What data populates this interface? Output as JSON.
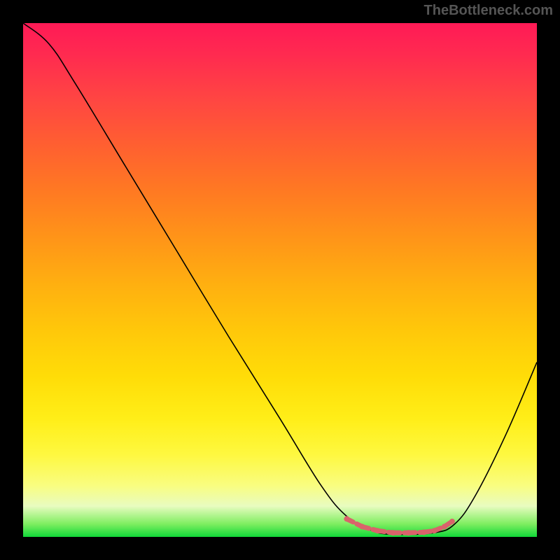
{
  "watermark": "TheBottleneck.com",
  "chart_data": {
    "type": "line",
    "title": "",
    "xlabel": "",
    "ylabel": "",
    "xlim": [
      0,
      100
    ],
    "ylim": [
      0,
      100
    ],
    "grid": false,
    "series": [
      {
        "name": "curve",
        "color": "#000000",
        "points": [
          {
            "x": 0,
            "y": 100
          },
          {
            "x": 5,
            "y": 96
          },
          {
            "x": 10,
            "y": 88.5
          },
          {
            "x": 20,
            "y": 72
          },
          {
            "x": 30,
            "y": 55.5
          },
          {
            "x": 40,
            "y": 39
          },
          {
            "x": 50,
            "y": 23
          },
          {
            "x": 58,
            "y": 10
          },
          {
            "x": 63,
            "y": 4
          },
          {
            "x": 68,
            "y": 1.2
          },
          {
            "x": 72,
            "y": 0.5
          },
          {
            "x": 80,
            "y": 0.8
          },
          {
            "x": 84,
            "y": 2.5
          },
          {
            "x": 88,
            "y": 8
          },
          {
            "x": 94,
            "y": 20
          },
          {
            "x": 100,
            "y": 34
          }
        ]
      },
      {
        "name": "marker-band",
        "color": "#d9636b",
        "points": [
          {
            "x": 63,
            "y": 3.5
          },
          {
            "x": 66,
            "y": 2
          },
          {
            "x": 69,
            "y": 1.2
          },
          {
            "x": 72,
            "y": 0.8
          },
          {
            "x": 75,
            "y": 0.8
          },
          {
            "x": 78,
            "y": 0.9
          },
          {
            "x": 80,
            "y": 1.2
          },
          {
            "x": 82,
            "y": 2
          },
          {
            "x": 83.5,
            "y": 3
          }
        ]
      }
    ],
    "background_gradient": {
      "top": "#ff1a56",
      "mid_upper": "#ff8020",
      "mid": "#ffd808",
      "mid_lower": "#fef860",
      "bottom": "#10d838"
    }
  }
}
